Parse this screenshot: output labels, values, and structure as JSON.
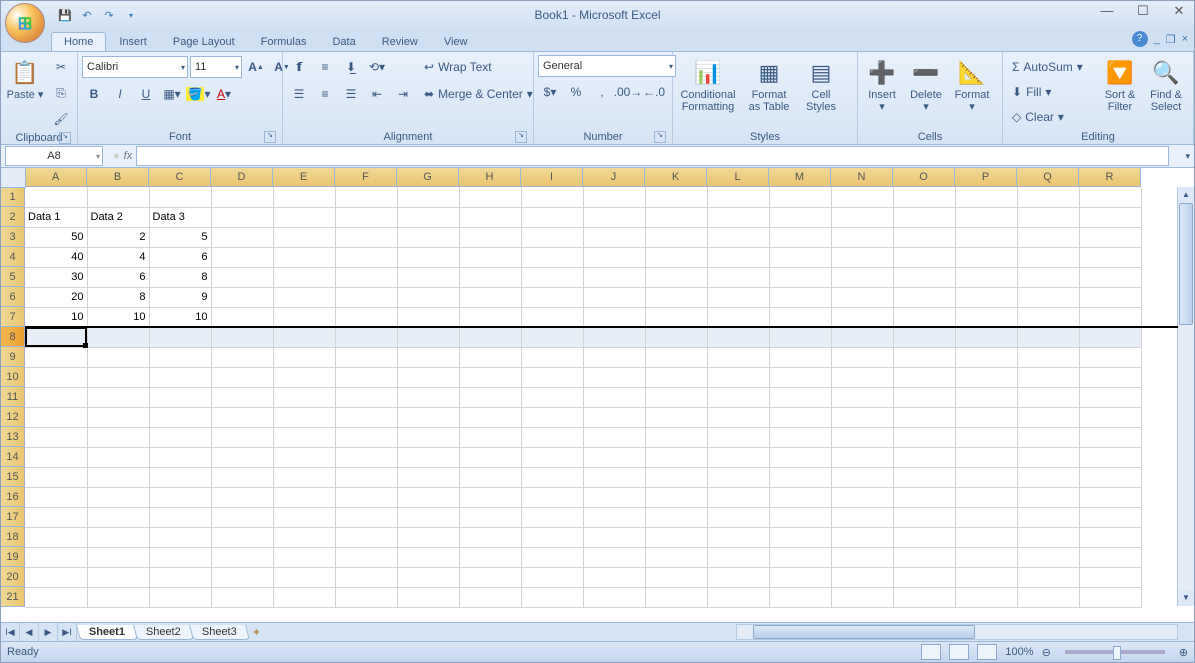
{
  "title": "Book1 - Microsoft Excel",
  "qat": {
    "save": "💾",
    "undo": "↶",
    "redo": "↷"
  },
  "tabs": [
    "Home",
    "Insert",
    "Page Layout",
    "Formulas",
    "Data",
    "Review",
    "View"
  ],
  "active_tab": "Home",
  "ribbon": {
    "clipboard": {
      "title": "Clipboard",
      "paste": "Paste"
    },
    "font": {
      "title": "Font",
      "name": "Calibri",
      "size": "11"
    },
    "alignment": {
      "title": "Alignment",
      "wrap": "Wrap Text",
      "merge": "Merge & Center"
    },
    "number": {
      "title": "Number",
      "format": "General"
    },
    "styles": {
      "title": "Styles",
      "cond": "Conditional\nFormatting",
      "table": "Format\nas Table",
      "cell": "Cell\nStyles"
    },
    "cells": {
      "title": "Cells",
      "insert": "Insert",
      "delete": "Delete",
      "format": "Format"
    },
    "editing": {
      "title": "Editing",
      "autosum": "AutoSum",
      "fill": "Fill",
      "clear": "Clear",
      "sort": "Sort &\nFilter",
      "find": "Find &\nSelect"
    }
  },
  "namebox": "A8",
  "columns": [
    "A",
    "B",
    "C",
    "D",
    "E",
    "F",
    "G",
    "H",
    "I",
    "J",
    "K",
    "L",
    "M",
    "N",
    "O",
    "P",
    "Q",
    "R"
  ],
  "row_count": 21,
  "selected_row": 8,
  "cells": {
    "2": {
      "A": "Data 1",
      "B": "Data 2",
      "C": "Data 3"
    },
    "3": {
      "A": "50",
      "B": "2",
      "C": "5"
    },
    "4": {
      "A": "40",
      "B": "4",
      "C": "6"
    },
    "5": {
      "A": "30",
      "B": "6",
      "C": "8"
    },
    "6": {
      "A": "20",
      "B": "8",
      "C": "9"
    },
    "7": {
      "A": "10",
      "B": "10",
      "C": "10"
    }
  },
  "numeric_rows": [
    3,
    4,
    5,
    6,
    7
  ],
  "chart_data": {
    "type": "table",
    "columns": [
      "Data 1",
      "Data 2",
      "Data 3"
    ],
    "rows": [
      [
        50,
        2,
        5
      ],
      [
        40,
        4,
        6
      ],
      [
        30,
        6,
        8
      ],
      [
        20,
        8,
        9
      ],
      [
        10,
        10,
        10
      ]
    ]
  },
  "sheets": [
    "Sheet1",
    "Sheet2",
    "Sheet3"
  ],
  "active_sheet": "Sheet1",
  "status": {
    "ready": "Ready",
    "zoom": "100%"
  }
}
